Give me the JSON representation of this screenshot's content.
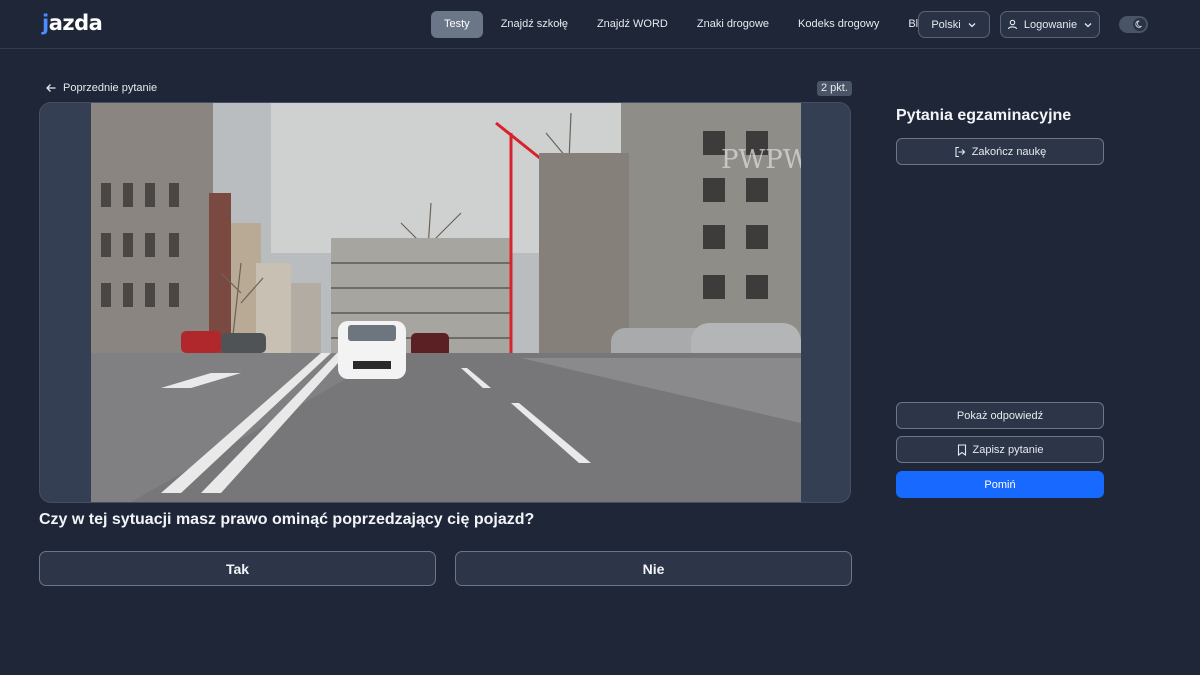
{
  "header": {
    "logo_text": "jazda",
    "nav": [
      {
        "label": "Testy",
        "active": true
      },
      {
        "label": "Znajdź szkołę"
      },
      {
        "label": "Znajdź WORD"
      },
      {
        "label": "Znaki drogowe"
      },
      {
        "label": "Kodeks drogowy"
      },
      {
        "label": "Blog"
      }
    ],
    "language": "Polski",
    "login": "Logowanie",
    "theme_toggle_icon": "moon-icon"
  },
  "question": {
    "back_label": "Poprzednie pytanie",
    "points": "2 pkt.",
    "media_watermark": "PWPW",
    "text": "Czy w tej sytuacji masz prawo ominąć poprzedzający cię pojazd?",
    "answers": [
      "Tak",
      "Nie"
    ]
  },
  "sidebar": {
    "title": "Pytania egzaminacyjne",
    "end_label": "Zakończ naukę",
    "show_answer_label": "Pokaż odpowiedź",
    "save_label": "Zapisz pytanie",
    "skip_label": "Pomiń"
  },
  "colors": {
    "background": "#1e2638",
    "accent": "#1769ff",
    "logo_accent": "#4a8dff"
  }
}
